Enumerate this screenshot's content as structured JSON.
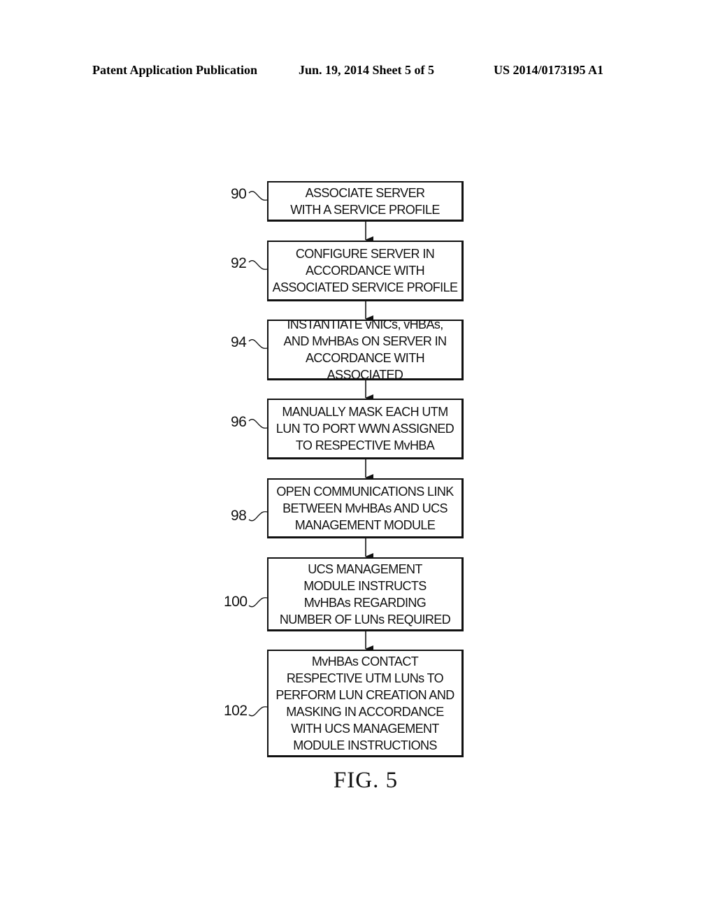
{
  "header": {
    "publication": "Patent Application Publication",
    "date_sheet": "Jun. 19, 2014  Sheet 5 of 5",
    "number": "US 2014/0173195 A1"
  },
  "steps": [
    {
      "ref": "90",
      "lines": [
        "ASSOCIATE SERVER",
        "WITH A SERVICE PROFILE"
      ]
    },
    {
      "ref": "92",
      "lines": [
        "CONFIGURE SERVER IN",
        "ACCORDANCE WITH",
        "ASSOCIATED SERVICE PROFILE"
      ]
    },
    {
      "ref": "94",
      "lines": [
        "INSTANTIATE vNICs, vHBAs,",
        "AND MvHBAs ON SERVER IN",
        "ACCORDANCE WITH ASSOCIATED"
      ]
    },
    {
      "ref": "96",
      "lines": [
        "MANUALLY MASK EACH UTM",
        "LUN TO PORT WWN ASSIGNED",
        "TO RESPECTIVE MvHBA"
      ]
    },
    {
      "ref": "98",
      "lines": [
        "OPEN COMMUNICATIONS LINK",
        "BETWEEN MvHBAs AND UCS",
        "MANAGEMENT MODULE"
      ]
    },
    {
      "ref": "100",
      "lines": [
        "UCS MANAGEMENT",
        "MODULE INSTRUCTS",
        "MvHBAs REGARDING",
        "NUMBER OF LUNs REQUIRED"
      ]
    },
    {
      "ref": "102",
      "lines": [
        "MvHBAs CONTACT",
        "RESPECTIVE UTM LUNs TO",
        "PERFORM LUN CREATION AND",
        "MASKING IN ACCORDANCE",
        "WITH UCS MANAGEMENT",
        "MODULE INSTRUCTIONS"
      ]
    }
  ],
  "figure_label": "FIG. 5"
}
